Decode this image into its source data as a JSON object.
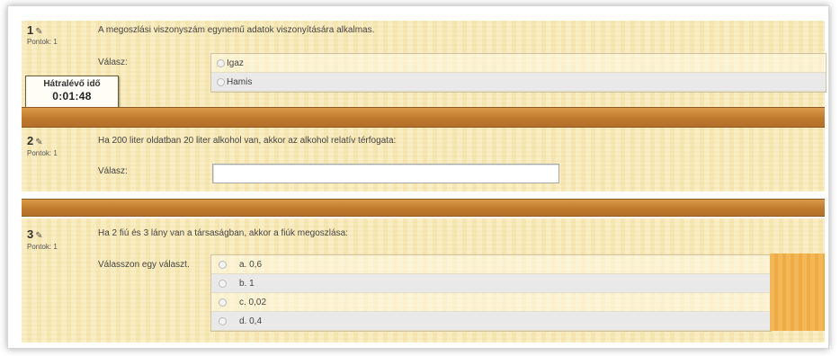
{
  "questions": [
    {
      "number": "1",
      "points_label": "Pontok: 1",
      "text": "A megoszlási viszonyszám egynemű adatok viszonyítására alkalmas.",
      "answer_label": "Válasz:",
      "options": [
        "Igaz",
        "Hamis"
      ]
    },
    {
      "number": "2",
      "points_label": "Pontok: 1",
      "text": "Ha 200 liter oldatban 20 liter alkohol van, akkor az alkohol relatív térfogata:",
      "answer_label": "Válasz:",
      "input_value": ""
    },
    {
      "number": "3",
      "points_label": "Pontok: 1",
      "text": "Ha 2 fiú és 3 lány van a társaságban, akkor a fiúk megoszlása:",
      "answer_label": "Válasszon egy választ.",
      "options": [
        "a. 0,6",
        "b. 1",
        "c. 0,02",
        "d. 0,4"
      ]
    }
  ],
  "timer": {
    "label": "Hátralévő idő",
    "value": "0:01:48"
  },
  "icons": {
    "edit": "pencil-icon",
    "radio": "radio-button"
  },
  "colors": {
    "panel": "#f8e9b6",
    "band": "#c98534",
    "accent_pane": "#f3b14a"
  }
}
